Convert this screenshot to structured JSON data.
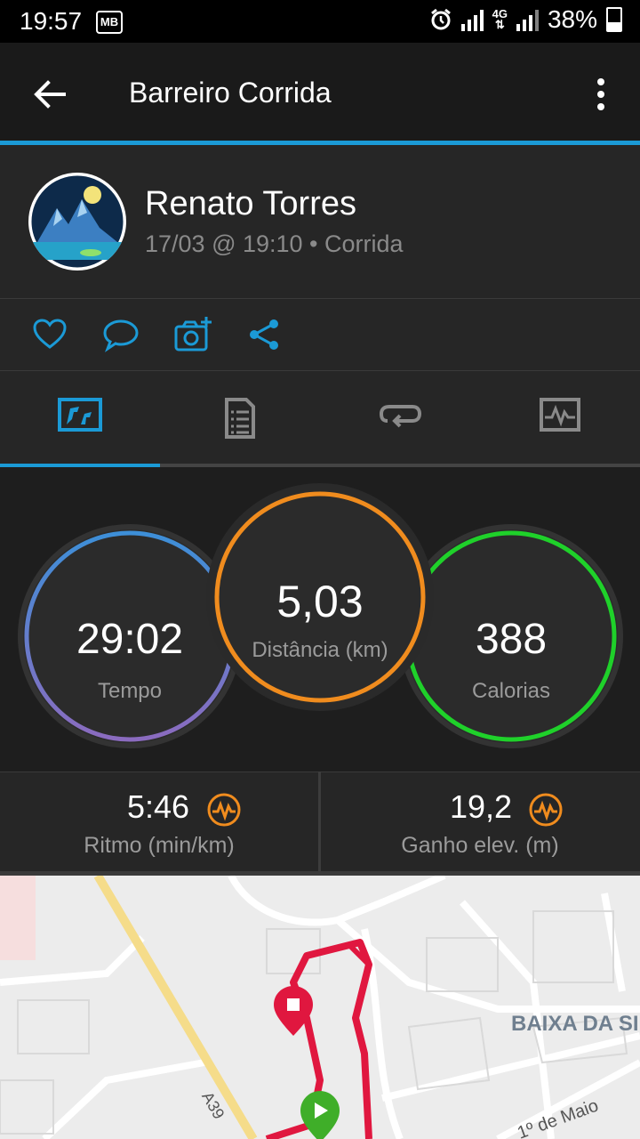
{
  "status_bar": {
    "time": "19:57",
    "carrier_badge": "MB",
    "network": "4G",
    "battery": "38%"
  },
  "app_bar": {
    "title": "Barreiro Corrida"
  },
  "profile": {
    "name": "Renato Torres",
    "meta": "17/03 @ 19:10 • Corrida"
  },
  "tabs": [
    "overview-icon",
    "details-icon",
    "laps-icon",
    "graph-icon"
  ],
  "stats": {
    "time": {
      "value": "29:02",
      "label": "Tempo"
    },
    "distance": {
      "value": "5,03",
      "label": "Distância (km)"
    },
    "calories": {
      "value": "388",
      "label": "Calorias"
    }
  },
  "metrics": {
    "pace": {
      "value": "5:46",
      "label": "Ritmo (min/km)"
    },
    "elevation": {
      "value": "19,2",
      "label": "Ganho elev. (m)"
    }
  },
  "map": {
    "area_label": "BAIXA DA SI",
    "road_label": "A39",
    "street_label": "1º de Maio"
  },
  "colors": {
    "accent": "#1b9ad6",
    "distance_ring": "#f08c1e",
    "calories_ring": "#1fd12a",
    "route": "#e0173f",
    "start_marker": "#3fae29"
  }
}
